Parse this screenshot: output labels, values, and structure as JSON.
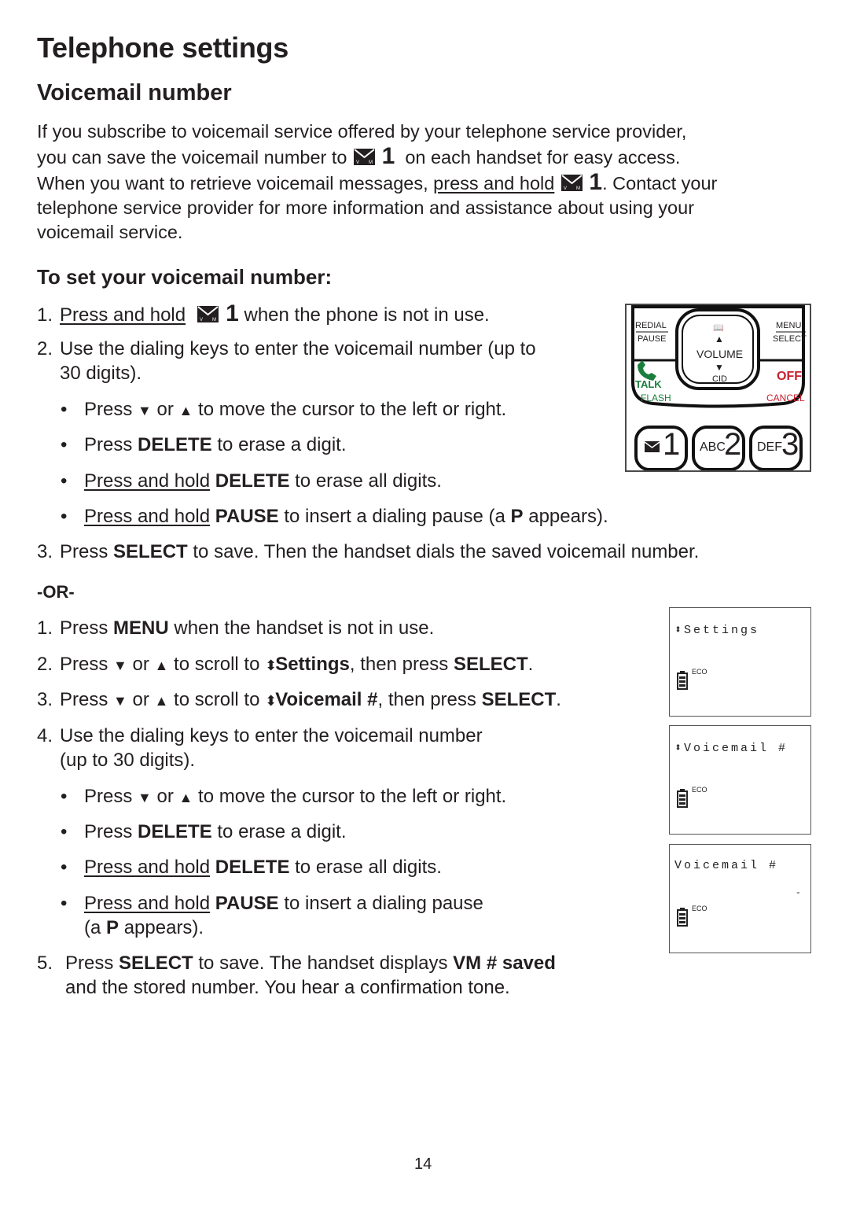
{
  "page": {
    "title": "Telephone settings",
    "section_title": "Voicemail number",
    "page_number": "14"
  },
  "intro": {
    "line1": "If you subscribe to voicemail service offered by your telephone service provider,",
    "line2_a": "you can save the voicemail number to",
    "line2_key": "1",
    "line2_b": "on each handset for easy access.",
    "line3_a": "When you want to retrieve voicemail messages,",
    "line3_link": "press and hold",
    "line3_key": "1",
    "line3_b": ". Contact your",
    "line4": "telephone service provider for more information and assistance about using your",
    "line5": "voicemail service."
  },
  "subsection": {
    "title": "To set your voicemail number:"
  },
  "method1": {
    "step1": {
      "num": "1.",
      "link": "Press and hold",
      "key": "1",
      "text": "when the phone is not in use."
    },
    "step2": {
      "num": "2.",
      "line1": "Use the dialing keys to enter the voicemail number (up to",
      "line2": "30 digits)."
    },
    "bullets": [
      {
        "pre": "Press",
        "down": "▼",
        "or": "or",
        "up": "▲",
        "post": "to move the cursor to the left or right."
      },
      {
        "pre": "Press",
        "bold": "DELETE",
        "post": "to erase a digit."
      },
      {
        "link": "Press and hold",
        "bold": "DELETE",
        "post": "to erase all digits."
      },
      {
        "link": "Press and hold",
        "bold": "PAUSE",
        "mid": "to insert a dialing pause (a",
        "bold2": "P",
        "post": "appears)."
      }
    ],
    "step3": {
      "num": "3.",
      "pre": "Press",
      "bold": "SELECT",
      "post": "to save. Then the handset dials the saved voicemail number."
    }
  },
  "or_label": "-OR-",
  "method2": {
    "step1": {
      "num": "1.",
      "pre": "Press",
      "bold": "MENU",
      "post": "when the handset is not in use."
    },
    "step2": {
      "num": "2.",
      "pre": "Press",
      "down": "▼",
      "or": "or",
      "up": "▲",
      "mid": "to scroll to",
      "arrow": "⬍",
      "bold": "Settings",
      "mid2": ", then press",
      "bold2": "SELECT",
      "post": "."
    },
    "step3": {
      "num": "3.",
      "pre": "Press",
      "down": "▼",
      "or": "or",
      "up": "▲",
      "mid": "to scroll to",
      "arrow": "⬍",
      "bold": "Voicemail #",
      "mid2": ", then press",
      "bold2": "SELECT",
      "post": "."
    },
    "step4": {
      "num": "4.",
      "line1": "Use the dialing keys to enter the voicemail number",
      "line2": "(up to 30 digits)."
    },
    "bullets": [
      {
        "pre": "Press",
        "down": "▼",
        "or": "or",
        "up": "▲",
        "post": "to move the cursor to the left or right."
      },
      {
        "pre": "Press",
        "bold": "DELETE",
        "post": "to erase a digit."
      },
      {
        "link": "Press and hold",
        "bold": "DELETE",
        "post": "to erase all digits."
      },
      {
        "link": "Press and hold",
        "bold": "PAUSE",
        "post": "to insert a dialing pause",
        "line2_pre": "(a",
        "line2_bold": "P",
        "line2_post": "appears)."
      }
    ],
    "step5": {
      "num": "5.",
      "pre": "Press",
      "bold": "SELECT",
      "mid": "to save. The handset displays",
      "bold2": "VM # saved",
      "line2": "and the stored number. You hear a confirmation tone."
    }
  },
  "keypad": {
    "redial": "REDIAL",
    "pause": "PAUSE",
    "menu": "MENU",
    "select": "SELECT",
    "volume": "VOLUME",
    "cid": "CID",
    "talk": "TALK",
    "flash": "FLASH",
    "off": "OFF",
    "cancel": "CANCEL",
    "key1_digit": "1",
    "key2_letters": "ABC",
    "key2_digit": "2",
    "key3_letters": "DEF",
    "key3_digit": "3",
    "colors": {
      "talk": "#1a7f3c",
      "off": "#c8202f"
    }
  },
  "screens": [
    {
      "title": "⬍Settings",
      "eco": "ECO",
      "entry": ""
    },
    {
      "title": "⬍Voicemail #",
      "eco": "ECO",
      "entry": ""
    },
    {
      "title": "Voicemail #",
      "eco": "ECO",
      "entry": "-"
    }
  ]
}
